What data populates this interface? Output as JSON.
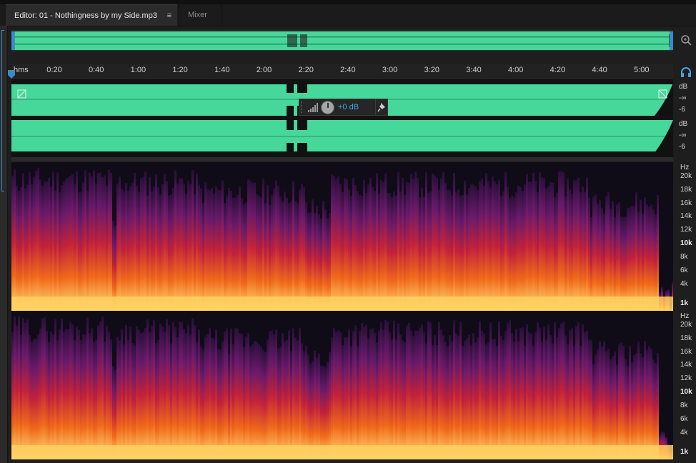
{
  "tabs": {
    "editor_label": "Editor: 01 - Nothingness by my Side.mp3",
    "menu_glyph": "≡",
    "mixer_label": "Mixer"
  },
  "ruler": {
    "unit": "hms",
    "labels": [
      "0:20",
      "0:40",
      "1:00",
      "1:20",
      "1:40",
      "2:00",
      "2:20",
      "2:40",
      "3:00",
      "3:20",
      "3:40",
      "4:00",
      "4:20",
      "4:40",
      "5:00"
    ]
  },
  "waveform_scale": {
    "unit_top": "dB",
    "inf_top": "-∞",
    "neg6_top": "-6",
    "unit_bottom": "dB",
    "inf_bottom": "-∞",
    "neg6_bottom": "-6"
  },
  "hud": {
    "value": "+0 dB"
  },
  "spectral_scale": {
    "top": {
      "unit": "Hz",
      "labels": [
        "20k",
        "18k",
        "16k",
        "14k",
        "12k",
        "10k",
        "8k",
        "6k",
        "4k",
        "1k"
      ]
    },
    "bottom": {
      "unit": "Hz",
      "labels": [
        "20k",
        "18k",
        "16k",
        "14k",
        "12k",
        "10k",
        "8k",
        "6k",
        "4k",
        "1k"
      ]
    }
  },
  "colors": {
    "waveform": "#46d79a",
    "accent": "#49a3e3",
    "playhead": "#3c8ac8"
  },
  "icons": {
    "menu": "hamburger-menu-icon",
    "zoom": "zoom-icon",
    "headphone": "headphone-icon",
    "volume": "volume-bars-icon",
    "knob": "volume-knob",
    "pin": "pin-icon"
  }
}
